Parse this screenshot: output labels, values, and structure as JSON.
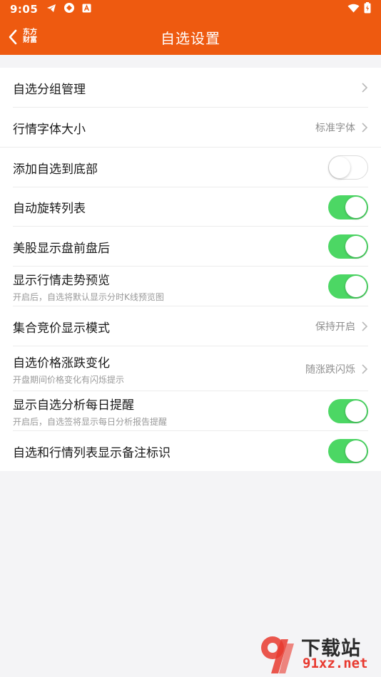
{
  "status_bar": {
    "time": "9:05",
    "left_icons": [
      "telegram-icon",
      "sync-icon",
      "text-a-icon"
    ],
    "right_icons": [
      "wifi-icon",
      "battery-icon"
    ]
  },
  "header": {
    "back_icon": "chevron-left-icon",
    "logo_line1": "东方",
    "logo_line2": "财富",
    "title": "自选设置",
    "bg_color": "#ee5a10"
  },
  "settings": [
    {
      "label": "自选分组管理",
      "control": "chevron"
    },
    {
      "label": "行情字体大小",
      "value": "标准字体",
      "control": "chevron"
    },
    {
      "label": "添加自选到底部",
      "control": "toggle",
      "on": false
    },
    {
      "label": "自动旋转列表",
      "control": "toggle",
      "on": true
    },
    {
      "label": "美股显示盘前盘后",
      "control": "toggle",
      "on": true
    },
    {
      "label": "显示行情走势预览",
      "sub": "开启后，自选将默认显示分时K线预览图",
      "control": "toggle",
      "on": true
    },
    {
      "label": "集合竞价显示模式",
      "value": "保持开启",
      "control": "chevron"
    },
    {
      "label": "自选价格涨跌变化",
      "sub": "开盘期间价格变化有闪烁提示",
      "value": "随涨跌闪烁",
      "control": "chevron"
    },
    {
      "label": "显示自选分析每日提醒",
      "sub": "开启后，自选签将显示每日分析报告提醒",
      "control": "toggle",
      "on": true
    },
    {
      "label": "自选和行情列表显示备注标识",
      "control": "toggle",
      "on": true
    }
  ],
  "toggle_on_color": "#4cd764",
  "watermark": {
    "text_top": "下载站",
    "text_bottom": "91xz.net"
  }
}
